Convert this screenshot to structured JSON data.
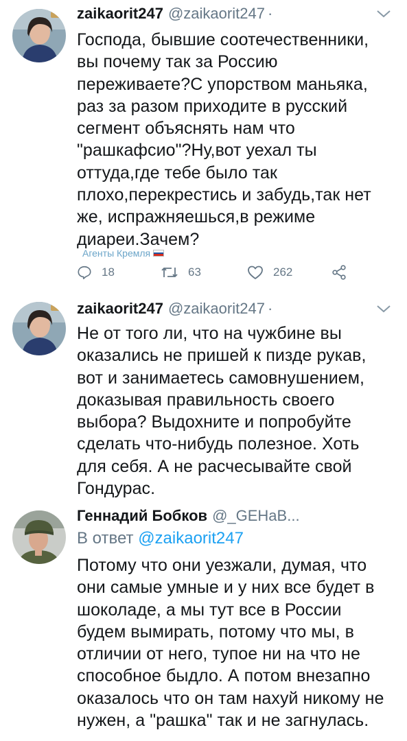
{
  "tweets": [
    {
      "display_name": "zaikaorit247",
      "handle": "@zaikaorit247",
      "separator": "·",
      "text": "Господа, бывшие соотечественники,\nвы почему так за Россию\nпереживаете?С упорством маньяка,\nраз за разом приходите в русский\nсегмент объяснять нам что\n\"рашкафсио\"?Ну,вот уехал ты\nоттуда,где тебе было так\nплохо,перекрестись и забудь,так нет\nже, испражняешься,в режиме\nдиареи.Зачем?",
      "tag": "Агенты Кремля",
      "replies": "18",
      "retweets": "63",
      "likes": "262"
    },
    {
      "display_name": "zaikaorit247",
      "handle": "@zaikaorit247",
      "separator": "·",
      "text": "Не от того ли, что на чужбине вы\nоказались не пришей к пизде рукав,\nвот и занимаетесь самовнушением,\nдоказывая правильность своего\nвыбора? Выдохните и попробуйте\nсделать что-нибудь полезное. Хоть\nдля себя. А не расчесывайте свой\nГондурас."
    },
    {
      "display_name": "Геннадий Бобков",
      "handle": "@_GEHaB...",
      "replying_prefix": "В ответ",
      "replying_to": "@zaikaorit247",
      "text": "Потому что они уезжали, думая, что\nони самые умные и у них все будет в\nшоколаде, а мы тут все в России\nбудем вымирать, потому что мы, в\nотличии от него, тупое ни на что не\nспособное быдло. А потом внезапно\nоказалось что он там нахуй никому не\nнужен, а \"рашка\" так и не загнулась."
    }
  ],
  "colors": {
    "text": "#14171a",
    "secondary": "#657786",
    "link": "#1da1f2",
    "tag": "#6aa4c8"
  },
  "icons": [
    "reply-icon",
    "retweet-icon",
    "like-icon",
    "share-icon",
    "chevron-down-icon"
  ]
}
